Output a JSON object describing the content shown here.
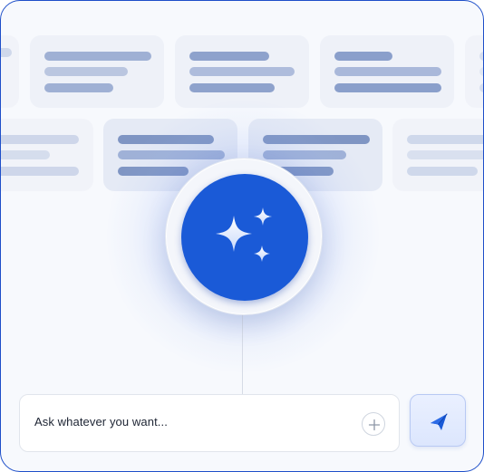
{
  "composer": {
    "placeholder": "Ask whatever you want..."
  },
  "icons": {
    "center": "sparkles-icon",
    "attach": "plus-icon",
    "send": "paper-plane-icon"
  },
  "colors": {
    "accent": "#1a5ad7",
    "frame_border": "#1e4fc9",
    "skeleton_dark": "#7f95c3",
    "skeleton_light": "#b6c3df"
  }
}
